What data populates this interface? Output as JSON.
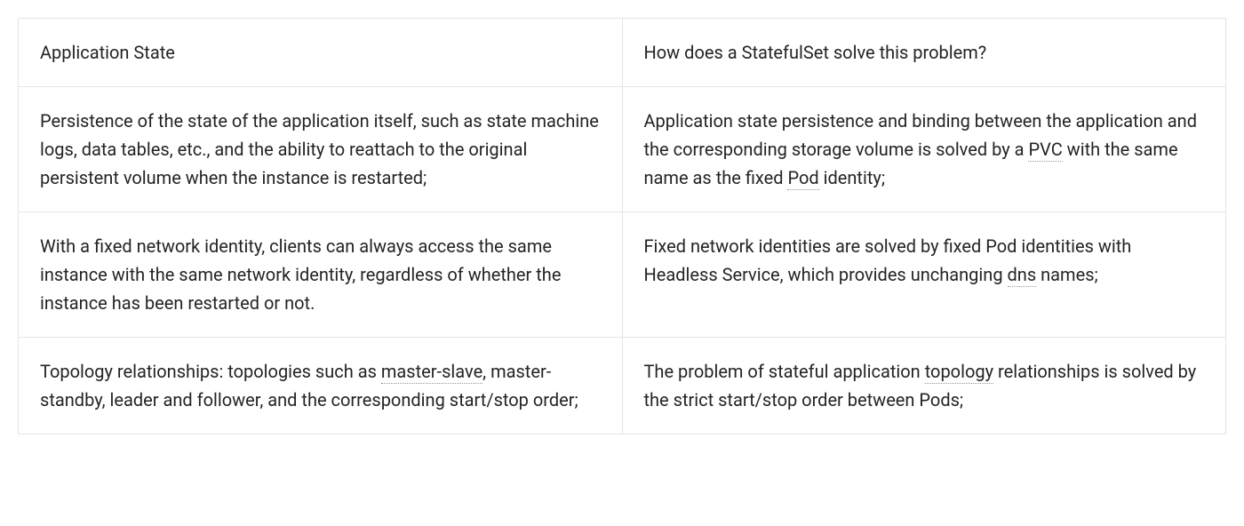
{
  "table": {
    "headers": [
      "Application State",
      "How does a StatefulSet solve this problem?"
    ],
    "rows": [
      {
        "col1_parts": [
          {
            "text": "Persistence of the state of the application itself, such as state machine logs, data tables, etc., and the ability to reattach to the original persistent volume when the instance is restarted;",
            "dotted": false
          }
        ],
        "col2_parts": [
          {
            "text": "Application state persistence and binding between the application and the corresponding storage volume is solved by a ",
            "dotted": false
          },
          {
            "text": "PVC",
            "dotted": true
          },
          {
            "text": " with the same name as the fixed ",
            "dotted": false
          },
          {
            "text": "Pod",
            "dotted": true
          },
          {
            "text": " identity;",
            "dotted": false
          }
        ]
      },
      {
        "col1_parts": [
          {
            "text": "With a fixed network identity, clients can always access the same instance with the same network identity, regardless of whether the instance has been restarted or not.",
            "dotted": false
          }
        ],
        "col2_parts": [
          {
            "text": "Fixed network identities are solved by fixed Pod identities with Headless Service, which provides unchanging ",
            "dotted": false
          },
          {
            "text": "dns",
            "dotted": true
          },
          {
            "text": " names;",
            "dotted": false
          }
        ]
      },
      {
        "col1_parts": [
          {
            "text": "Topology relationships: topologies such as ",
            "dotted": false
          },
          {
            "text": "master-slave",
            "dotted": true
          },
          {
            "text": ", master-standby, leader and follower, and the corresponding start/stop order;",
            "dotted": false
          }
        ],
        "col2_parts": [
          {
            "text": "The problem of stateful application ",
            "dotted": false
          },
          {
            "text": "topology",
            "dotted": true
          },
          {
            "text": " relationships is solved by the strict start/stop order between Pods;",
            "dotted": false
          }
        ]
      }
    ]
  }
}
